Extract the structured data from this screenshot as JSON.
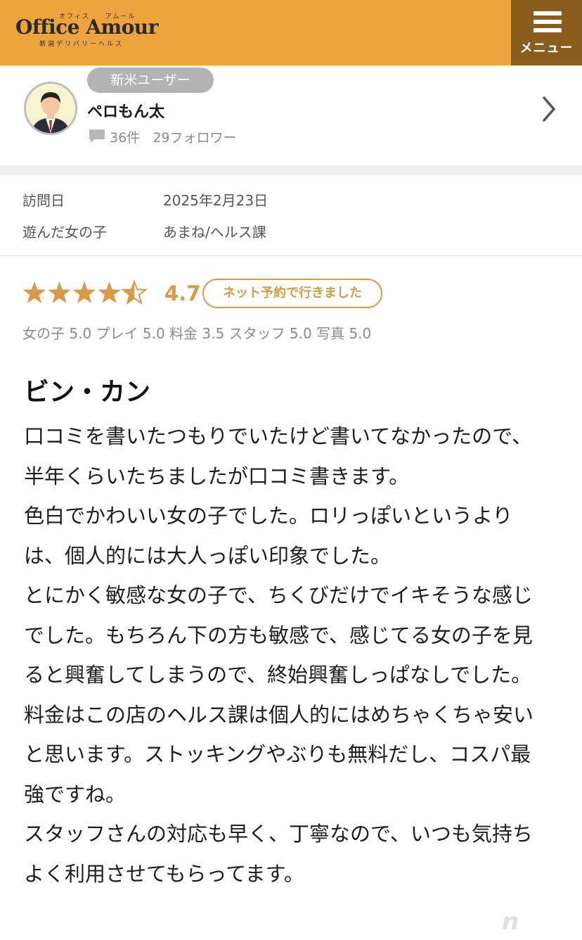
{
  "header": {
    "logo_text": "Office Amour",
    "logo_ruby_left": "オフィス",
    "logo_ruby_right": "アムール",
    "logo_subtitle": "新潟デリバリーヘルス",
    "menu_label": "メニュー",
    "background_color": "#eea43c",
    "menu_color": "#8a5d1d"
  },
  "user": {
    "badge": "新米ユーザー",
    "name": "ペロもん太",
    "reviews_count": "36件",
    "followers": "29フォロワー",
    "avatar_icon": "user-avatar-icon"
  },
  "visit": {
    "date_label": "訪問日",
    "date_value": "2025年2月23日",
    "girl_label": "遊んだ女の子",
    "girl_value": "あまね/ヘルス課"
  },
  "rating": {
    "stars": 4.5,
    "max_stars": 5,
    "score": "4.7",
    "badge": "ネット予約で行きました",
    "star_color": "#d89a45",
    "subscores_text": "女の子 5.0 プレイ 5.0 料金 3.5 スタッフ 5.0 写真 5.0"
  },
  "review": {
    "title": "ビン・カン",
    "paragraphs": [
      "口コミを書いたつもりでいたけど書いてなかったので、半年くらいたちましたが口コミ書きます。",
      "色白でかわいい女の子でした。ロリっぽいというよりは、個人的には大人っぽい印象でした。",
      "とにかく敏感な女の子で、ちくびだけでイキそうな感じでした。もちろん下の方も敏感で、感じてる女の子を見ると興奮してしまうので、終始興奮しっぱなしでした。",
      "料金はこの店のヘルス課は個人的にはめちゃくちゃ安いと思います。ストッキングやぶりも無料だし、コスパ最強ですね。",
      "スタッフさんの対応も早く、丁寧なので、いつも気持ちよく利用させてもらってます。"
    ]
  },
  "watermark": "n"
}
